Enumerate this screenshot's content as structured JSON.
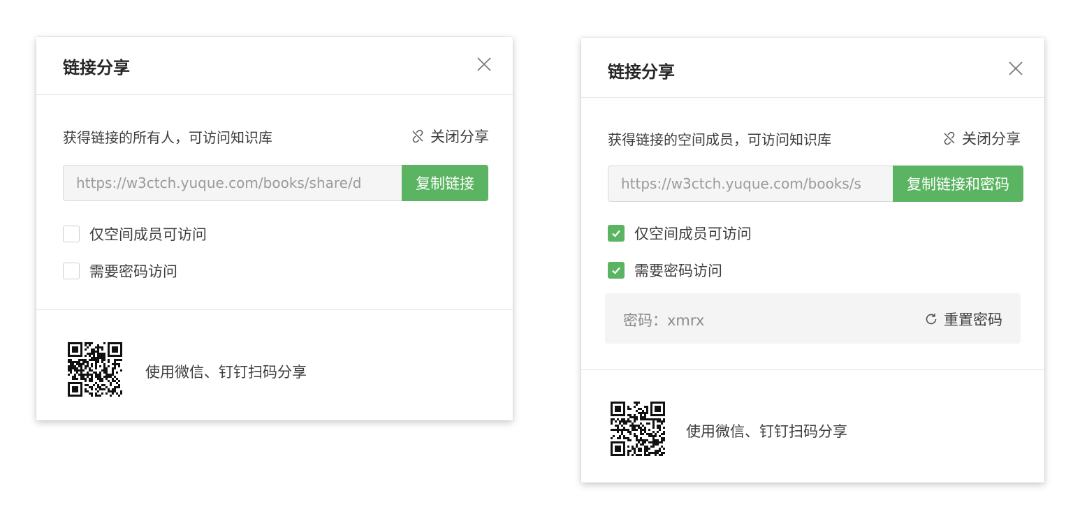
{
  "colors": {
    "accent": "#5bb462",
    "border": "#d9d9d9",
    "divider": "#e6e6e6",
    "pw_bg": "#f4f4f4"
  },
  "dialog_left": {
    "title": "链接分享",
    "close_icon": "close-icon",
    "description": "获得链接的所有人，可访问知识库",
    "stop_share_icon": "link-broken-icon",
    "stop_share_label": "关闭分享",
    "link_value": "https://w3ctch.yuque.com/books/share/d",
    "copy_label": "复制链接",
    "option_members_only": {
      "label": "仅空间成员可访问",
      "checked": false
    },
    "option_password": {
      "label": "需要密码访问",
      "checked": false
    },
    "qr_icon": "qr-code-icon",
    "qr_text": "使用微信、钉钉扫码分享"
  },
  "dialog_right": {
    "title": "链接分享",
    "close_icon": "close-icon",
    "description": "获得链接的空间成员，可访问知识库",
    "stop_share_icon": "link-broken-icon",
    "stop_share_label": "关闭分享",
    "link_value": "https://w3ctch.yuque.com/books/s",
    "copy_label": "复制链接和密码",
    "option_members_only": {
      "label": "仅空间成员可访问",
      "checked": true
    },
    "option_password": {
      "label": "需要密码访问",
      "checked": true
    },
    "password_text": "密码：xmrx",
    "reset_icon": "refresh-icon",
    "reset_label": "重置密码",
    "qr_icon": "qr-code-icon",
    "qr_text": "使用微信、钉钉扫码分享"
  }
}
